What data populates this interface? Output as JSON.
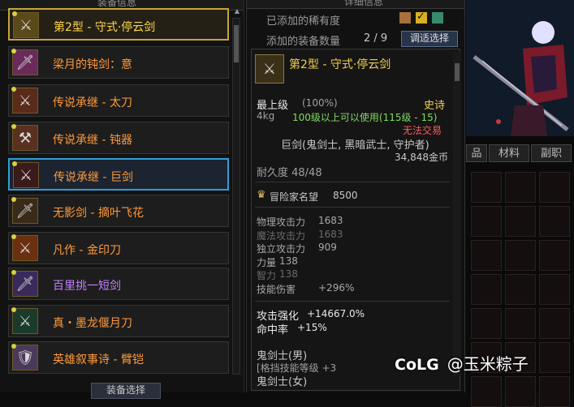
{
  "left_panel": {
    "header": "装备信息",
    "items": [
      {
        "label": "第2型 - 守式·停云剑",
        "color": "#ffd84a",
        "icon": "sword-icon",
        "icon_bg": "#5a4a1a"
      },
      {
        "label": "梁月的钝剑：意",
        "color": "#ff9a3c",
        "icon": "blunt-sword-icon",
        "icon_bg": "#6a2a5a"
      },
      {
        "label": "传说承继 - 太刀",
        "color": "#ff9a3c",
        "icon": "katana-icon",
        "icon_bg": "#5a2a1a"
      },
      {
        "label": "传说承继 - 钝器",
        "color": "#ff9a3c",
        "icon": "club-icon",
        "icon_bg": "#5a3020"
      },
      {
        "label": "传说承继 - 巨剑",
        "color": "#ff9a3c",
        "icon": "greatsword-icon",
        "icon_bg": "#3a1a1a"
      },
      {
        "label": "无影剑 - 摘叶飞花",
        "color": "#ff9a3c",
        "icon": "shadow-sword-icon",
        "icon_bg": "#3a2a1a"
      },
      {
        "label": "凡作 - 金印刀",
        "color": "#ff9a3c",
        "icon": "golden-blade-icon",
        "icon_bg": "#6a3010"
      },
      {
        "label": "百里挑一短剑",
        "color": "#c080ff",
        "icon": "short-sword-icon",
        "icon_bg": "#3a2a5a"
      },
      {
        "label": "真・墨龙偃月刀",
        "color": "#ff9a3c",
        "icon": "dragon-blade-icon",
        "icon_bg": "#1a3a2a"
      },
      {
        "label": "英雄叙事诗 - 臂铠",
        "color": "#ff9a3c",
        "icon": "gauntlet-icon",
        "icon_bg": "#4a3a5a"
      }
    ],
    "bottom_button": "装备选择"
  },
  "mid_panel": {
    "header": "详细信息",
    "rarity_label": "已添加的稀有度",
    "rarity_boxes": [
      {
        "color": "#a8703a",
        "checked": false
      },
      {
        "color": "#d8b020",
        "checked": true
      },
      {
        "color": "#3a8a6a",
        "checked": false
      }
    ],
    "count_label": "添加的装备数量",
    "count_value": "2 / 9",
    "adjust_button": "调适选择",
    "detail": {
      "title": "第2型 - 守式·停云剑",
      "grade": "最上级",
      "grade_pct": "(100%)",
      "rarity": "史诗",
      "weight": "4kg",
      "level_req": "100级以上可以使用(115级 - 15)",
      "trade": "无法交易",
      "type": "巨剑(鬼剑士, 黑暗武士, 守护者)",
      "price": "34,848金币",
      "durability": "耐久度 48/48",
      "fame_label": "冒险家名望",
      "fame_value": "8500",
      "stats": [
        {
          "label": "物理攻击力",
          "value": "1683",
          "dim": false
        },
        {
          "label": "魔法攻击力",
          "value": "1683",
          "dim": true
        },
        {
          "label": "独立攻击力",
          "value": "909",
          "dim": false
        },
        {
          "label": "力量",
          "value": "138",
          "dim": false
        },
        {
          "label": "智力",
          "value": "138",
          "dim": true
        },
        {
          "label": "技能伤害",
          "value": "+296%",
          "dim": false
        }
      ],
      "enhance_label": "攻击强化",
      "enhance_value": "+14667.0%",
      "hit_label": "命中率",
      "hit_value": "+15%",
      "class_1": "鬼剑士(男)",
      "skill_1": "[格挡技能等级 +3",
      "class_2": "鬼剑士(女)"
    }
  },
  "right_panel": {
    "tabs": [
      "品",
      "材料",
      "副职"
    ]
  },
  "watermark": {
    "logo": "CoLG",
    "text": "@玉米粽子"
  }
}
